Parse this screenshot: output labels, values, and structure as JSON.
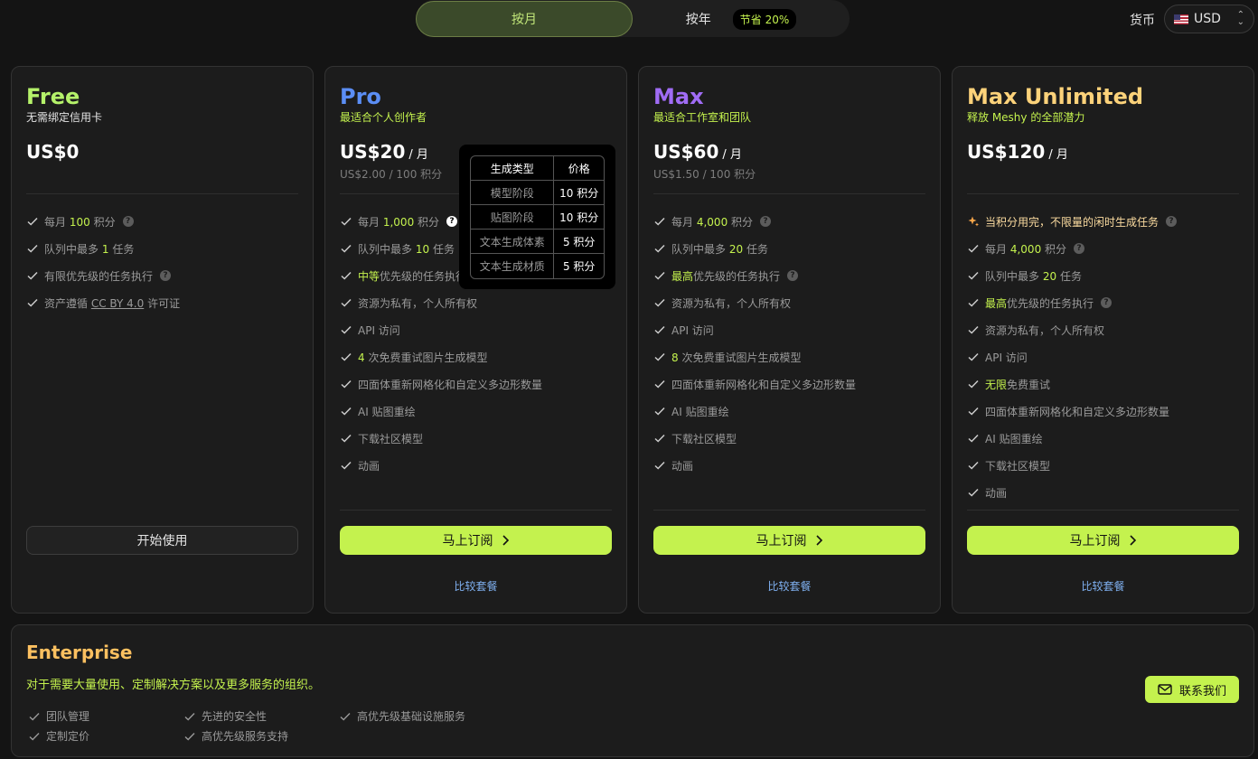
{
  "billing": {
    "monthly": "按月",
    "yearly": "按年",
    "save_badge": "节省 20%"
  },
  "currency": {
    "label": "货币",
    "value": "USD"
  },
  "free": {
    "name": "Free",
    "tagline": "无需绑定信用卡",
    "price": "US$0",
    "features": [
      "每月",
      "100",
      "积分",
      "队列中最多",
      "1",
      "任务",
      "有限优先级的任务执行",
      "资产遵循",
      "CC BY 4.0",
      "许可证"
    ],
    "button": "开始使用"
  },
  "pro": {
    "name": "Pro",
    "tagline": "最适合个人创作者",
    "price": "US$20",
    "per": "/ 月",
    "sub": "US$2.00 / 100 积分",
    "f_credit_pre": "每月",
    "f_credit_val": "1,000",
    "f_credit_suf": "积分",
    "f_queue_pre": "队列中最多",
    "f_queue_val": "10",
    "f_queue_suf": "任务",
    "f_prio_hl": "中等",
    "f_prio": "优先级的任务执行",
    "f_private": "资源为私有，个人所有权",
    "f_api": "API 访问",
    "f_retry_val": "4",
    "f_retry": "次免费重试图片生成模型",
    "f_remesh": "四面体重新网格化和自定义多边形数量",
    "f_texture": "AI 贴图重绘",
    "f_download": "下载社区模型",
    "f_anim": "动画",
    "button": "马上订阅",
    "compare": "比较套餐"
  },
  "max": {
    "name": "Max",
    "tagline": "最适合工作室和团队",
    "price": "US$60",
    "per": "/ 月",
    "sub": "US$1.50 / 100 积分",
    "f_credit_pre": "每月",
    "f_credit_val": "4,000",
    "f_credit_suf": "积分",
    "f_queue_pre": "队列中最多",
    "f_queue_val": "20",
    "f_queue_suf": "任务",
    "f_prio_hl": "最高",
    "f_prio": "优先级的任务执行",
    "f_private": "资源为私有，个人所有权",
    "f_api": "API 访问",
    "f_retry_val": "8",
    "f_retry": "次免费重试图片生成模型",
    "f_remesh": "四面体重新网格化和自定义多边形数量",
    "f_texture": "AI 贴图重绘",
    "f_download": "下载社区模型",
    "f_anim": "动画",
    "button": "马上订阅",
    "compare": "比较套餐"
  },
  "unlimited": {
    "name": "Max Unlimited",
    "tagline": "释放 Meshy 的全部潜力",
    "price": "US$120",
    "per": "/ 月",
    "f_star": "当积分用完，不限量的闲时生成任务",
    "f_credit_pre": "每月",
    "f_credit_val": "4,000",
    "f_credit_suf": "积分",
    "f_queue_pre": "队列中最多",
    "f_queue_val": "20",
    "f_queue_suf": "任务",
    "f_prio_hl": "最高",
    "f_prio": "优先级的任务执行",
    "f_private": "资源为私有，个人所有权",
    "f_api": "API 访问",
    "f_retry_hl": "无限",
    "f_retry": "免费重试",
    "f_remesh": "四面体重新网格化和自定义多边形数量",
    "f_texture": "AI 贴图重绘",
    "f_download": "下载社区模型",
    "f_anim": "动画",
    "button": "马上订阅",
    "compare": "比较套餐"
  },
  "tooltip": {
    "headers": [
      "生成类型",
      "价格"
    ],
    "rows": [
      [
        "模型阶段",
        "10 积分"
      ],
      [
        "贴图阶段",
        "10 积分"
      ],
      [
        "文本生成体素",
        "5 积分"
      ],
      [
        "文本生成材质",
        "5 积分"
      ]
    ]
  },
  "enterprise": {
    "title": "Enterprise",
    "desc": "对于需要大量使用、定制解决方案以及更多服务的组织。",
    "features": [
      "团队管理",
      "先进的安全性",
      "高优先级基础设施服务",
      "定制定价",
      "高优先级服务支持"
    ],
    "button": "联系我们"
  },
  "colors": {
    "accent": "#c4f24e",
    "free": "#b5f26a",
    "pro": "#5b8ef5",
    "max": "#a06cf5",
    "unlimited": "#fcd27a",
    "enterprise": "#fcc060"
  }
}
